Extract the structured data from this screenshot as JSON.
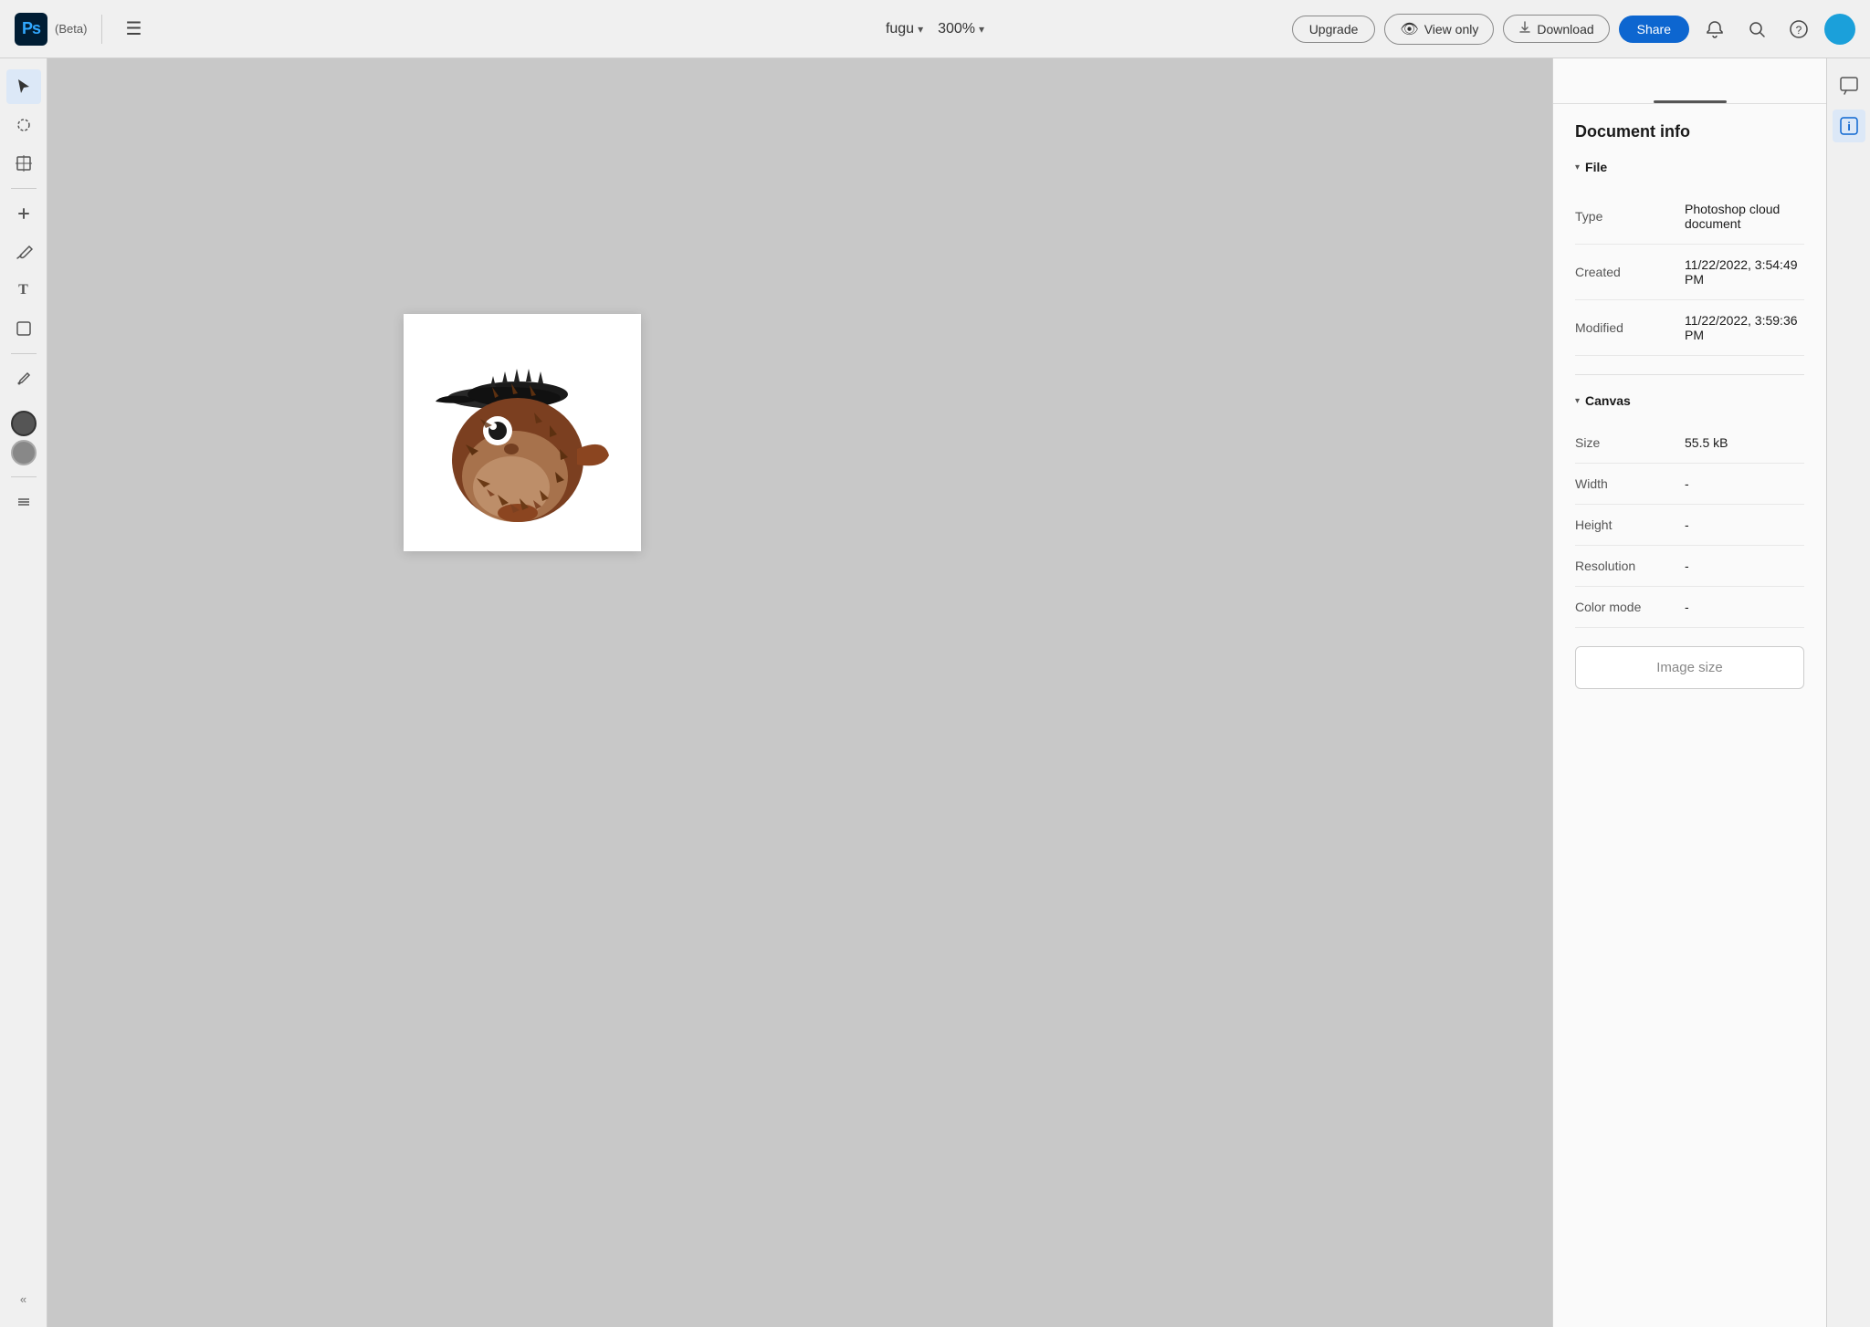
{
  "app": {
    "logo": "Ps",
    "beta": "(Beta)"
  },
  "header": {
    "hamburger_label": "☰",
    "filename": "fugu",
    "filename_dropdown": "▾",
    "zoom": "300%",
    "zoom_dropdown": "▾",
    "upgrade_label": "Upgrade",
    "view_only_label": "View only",
    "view_only_icon": "👁",
    "download_label": "Download",
    "download_icon": "⬇",
    "share_label": "Share",
    "notifications_icon": "🔔",
    "search_icon": "🔍",
    "help_icon": "?",
    "avatar_initial": ""
  },
  "toolbar": {
    "tools": [
      {
        "name": "select-tool",
        "icon": "↖",
        "active": true
      },
      {
        "name": "lasso-tool",
        "icon": "◎"
      },
      {
        "name": "transform-tool",
        "icon": "⊹"
      },
      {
        "name": "healing-tool",
        "icon": "🩹"
      },
      {
        "name": "brush-tool",
        "icon": "✏"
      },
      {
        "name": "type-tool",
        "icon": "T"
      },
      {
        "name": "shape-tool",
        "icon": "❖"
      },
      {
        "name": "eyedropper-tool",
        "icon": "💉"
      }
    ]
  },
  "panel": {
    "title": "Document info",
    "file_section_label": "File",
    "canvas_section_label": "Canvas",
    "rows": [
      {
        "key": "type",
        "label": "Type",
        "value": "Photoshop cloud document"
      },
      {
        "key": "created",
        "label": "Created",
        "value": "11/22/2022, 3:54:49 PM"
      },
      {
        "key": "modified",
        "label": "Modified",
        "value": "11/22/2022, 3:59:36 PM"
      }
    ],
    "canvas_rows": [
      {
        "key": "size",
        "label": "Size",
        "value": "55.5 kB"
      },
      {
        "key": "width",
        "label": "Width",
        "value": "-"
      },
      {
        "key": "height",
        "label": "Height",
        "value": "-"
      },
      {
        "key": "resolution",
        "label": "Resolution",
        "value": "-"
      },
      {
        "key": "color_mode",
        "label": "Color mode",
        "value": "-"
      }
    ],
    "image_size_btn_label": "Image size"
  },
  "side_icons": [
    {
      "name": "comment-icon",
      "icon": "💬",
      "active": false
    },
    {
      "name": "info-icon",
      "icon": "ℹ",
      "active": true
    }
  ],
  "colors": {
    "accent_blue": "#0d66d0",
    "panel_bg": "#fafafa",
    "toolbar_bg": "#f0f0f0",
    "canvas_bg": "#c8c8c8"
  }
}
